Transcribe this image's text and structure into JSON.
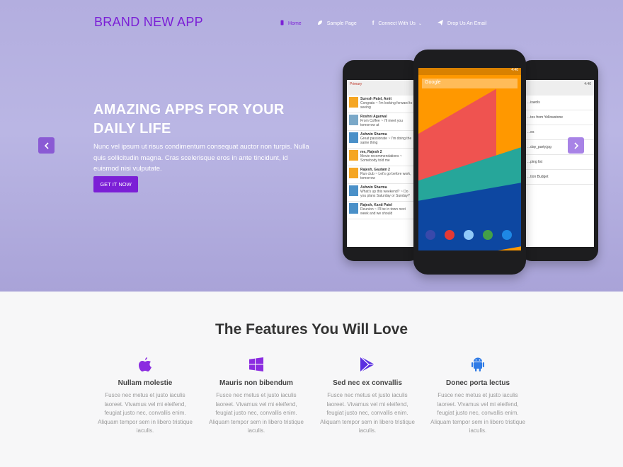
{
  "header": {
    "brand": "BRAND NEW APP",
    "nav": [
      {
        "label": "Home",
        "icon": "mobile-icon",
        "active": true
      },
      {
        "label": "Sample Page",
        "icon": "leaf-icon"
      },
      {
        "label": "Connect With Us",
        "icon": "facebook-icon",
        "has_dropdown": true
      },
      {
        "label": "Drop Us An Email",
        "icon": "paper-plane-icon"
      }
    ]
  },
  "hero": {
    "title_line1": "AMAZING APPS FOR YOUR",
    "title_line2": "DAILY LIFE",
    "description": "Nunc vel ipsum ut risus condimentum consequat auctor non turpis. Nulla quis sollicitudin magna. Cras scelerisque eros in ante tincidunt, id euismod nisi vulputate.",
    "cta": "GET IT NOW",
    "prev_icon": "chevron-left-icon",
    "next_icon": "chevron-right-icon"
  },
  "phones": {
    "left_inbox_label": "Primary",
    "left_rows": [
      {
        "name": "Suresh Patel, Amit",
        "snippet": "Congrats ~ I'm looking forward to seeing"
      },
      {
        "name": "Roshni Agarwal",
        "snippet": "From Coffee ~ I'll meet you tomorrow at"
      },
      {
        "name": "Ashwin Sharma",
        "snippet": "Great passionate ~ I'm doing the same thing"
      },
      {
        "name": "me, Rajesh 2",
        "snippet": "Movie recommendations ~ Somebody told me"
      },
      {
        "name": "Rajesh, Gautam 2",
        "snippet": "Run club ~ Let's go before work, tomorrow"
      },
      {
        "name": "Ashwin Sharma",
        "snippet": "What's up this weekend? ~ Do you plans Saturday or Sunday?"
      },
      {
        "name": "Rajesh, Kanti Patel",
        "snippet": "Reunion ~ I'll be in town next week and we should"
      }
    ],
    "center_search": "Google",
    "center_time": "4:40",
    "right_time": "4:40",
    "right_rows": [
      "...iswols",
      "...tos from Yellowstone",
      "...es",
      "...day_party.jpg",
      "...ping list",
      "...tion Budget"
    ]
  },
  "features": {
    "title": "The Features You Will Love",
    "items": [
      {
        "name": "Nullam molestie",
        "icon": "apple-icon",
        "color": "#8b2ce0",
        "desc": "Fusce nec metus et justo iaculis laoreet. Vivamus vel mi eleifend, feugiat justo nec, convallis enim. Aliquam tempor sem in libero tristique iaculis."
      },
      {
        "name": "Mauris non bibendum",
        "icon": "windows-icon",
        "color": "#8b2ce0",
        "desc": "Fusce nec metus et justo iaculis laoreet. Vivamus vel mi eleifend, feugiat justo nec, convallis enim. Aliquam tempor sem in libero tristique iaculis."
      },
      {
        "name": "Sed nec ex convallis",
        "icon": "play-store-icon",
        "color": "#5a2ee0",
        "desc": "Fusce nec metus et justo iaculis laoreet. Vivamus vel mi eleifend, feugiat justo nec, convallis enim. Aliquam tempor sem in libero tristique iaculis."
      },
      {
        "name": "Donec porta lectus",
        "icon": "android-icon",
        "color": "#2f7be6",
        "desc": "Fusce nec metus et justo iaculis laoreet. Vivamus vel mi eleifend, feugiat justo nec, convallis enim. Aliquam tempor sem in libero tristique iaculis."
      }
    ]
  },
  "colors": {
    "accent": "#7b1fd6",
    "hero_bg": "#b7b2e2"
  }
}
